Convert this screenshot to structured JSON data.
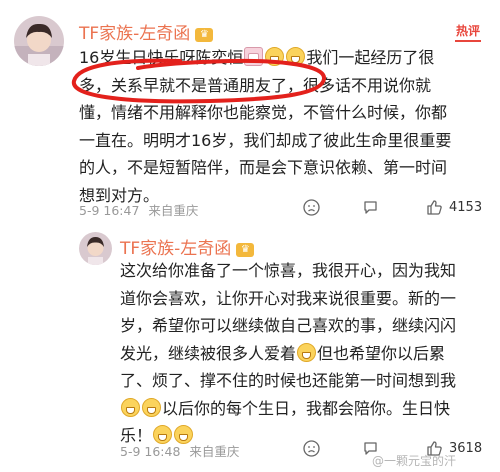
{
  "post1": {
    "username": "TF家族-左奇函",
    "badge": "热评",
    "text_line1": "16岁生日快乐呀陈奕恒",
    "text_line1_after": "我们一起经历了很",
    "text_line2_a": "多，",
    "text_line2_b": "关系早就不是普通朋友了，",
    "text_line2_c": "很多话不用说你就",
    "text_line3": "懂，情绪不用解释你也能察觉，不管什么时候，你都",
    "text_line4": "一直在。明明才16岁，我们却成了彼此生命里很重要",
    "text_line5": "的人，不是短暂陪伴，而是会下意识依赖、第一时间",
    "text_line6": "想到对方。",
    "time": "5-9 16:47",
    "location": "来自重庆",
    "likes": "4153"
  },
  "reply": {
    "username": "TF家族-左奇函",
    "lines": [
      "这次给你准备了一个惊喜，我很开心，因为我知",
      "道你会喜欢，让你开心对我来说很重要。新的一",
      "岁，希望你可以继续做自己喜欢的事，继续闪闪",
      "发光，继续被很多人爱着",
      "但也希望你以后累",
      "了、烦了、撑不住的时候也还能第一时间想到我",
      "以后你的每个生日，我都会陪你。生日快",
      "乐！"
    ],
    "time": "5-9 16:48",
    "location": "来自重庆",
    "likes": "3618"
  },
  "watermark": "@一颗元宝的汗",
  "colors": {
    "username": "#eb7350",
    "hot": "#e8463c",
    "circle": "#e3211c",
    "meta": "#999999"
  },
  "icons": [
    "avatar",
    "crown-badge-icon",
    "emoji-grin-icon",
    "cake-icon",
    "frown-icon",
    "comment-icon",
    "like-icon"
  ]
}
